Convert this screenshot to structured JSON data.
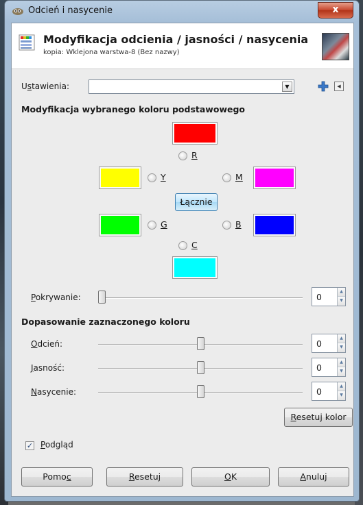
{
  "window": {
    "title": "Odcień i nasycenie",
    "close_label": "x"
  },
  "header": {
    "title": "Modyfikacja odcienia / jasności / nasycenia",
    "subtitle": "kopia: Wklejona warstwa-8 (Bez nazwy)"
  },
  "settings": {
    "label_prefix": "U",
    "label_u": "s",
    "label_rest": "tawienia:",
    "value": ""
  },
  "primary_section": {
    "title": "Modyfikacja wybranego koloru podstawowego"
  },
  "colors": {
    "R": {
      "label": "R",
      "hex": "#ff0000"
    },
    "Y": {
      "label": "Y",
      "hex": "#ffff00"
    },
    "M": {
      "label": "M",
      "hex": "#ff00ff"
    },
    "G": {
      "label": "G",
      "hex": "#00ff00"
    },
    "B": {
      "label": "B",
      "hex": "#0000ff"
    },
    "C": {
      "label": "C",
      "hex": "#00ffff"
    }
  },
  "all_button": {
    "label": "Łącznie"
  },
  "overlap": {
    "label_u": "P",
    "label_rest": "okrywanie:",
    "value": "0",
    "level": 0
  },
  "adjust_section": {
    "title": "Dopasowanie zaznaczonego koloru"
  },
  "sliders": [
    {
      "label_u": "O",
      "label_rest": "dcień:",
      "value": "0",
      "level": 0.5
    },
    {
      "label_u": "J",
      "label_rest": "asność:",
      "value": "0",
      "level": 0.5
    },
    {
      "label_u": "N",
      "label_rest": "asycenie:",
      "value": "0",
      "level": 0.5
    }
  ],
  "reset_color": {
    "label_u": "R",
    "label_rest": "esetuj kolor"
  },
  "preview": {
    "label_u": "P",
    "label_rest": "odgląd",
    "checked": true
  },
  "buttons": {
    "help": {
      "prefix": "Pomo",
      "u": "c"
    },
    "reset": {
      "u": "R",
      "rest": "esetuj"
    },
    "ok": {
      "u": "O",
      "rest": "K"
    },
    "cancel": {
      "u": "A",
      "rest": "nuluj"
    }
  }
}
